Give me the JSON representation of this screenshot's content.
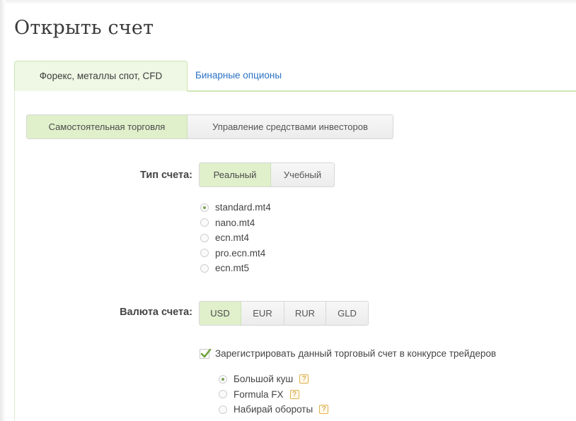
{
  "page": {
    "title": "Открыть счет"
  },
  "main_tabs": [
    {
      "label": "Форекс, металлы спот, CFD",
      "active": true
    },
    {
      "label": "Бинарные опционы",
      "active": false
    }
  ],
  "trade_mode": {
    "options": [
      {
        "label": "Самостоятельная торговля",
        "active": true
      },
      {
        "label": "Управление средствами инвесторов",
        "active": false
      }
    ]
  },
  "account_type": {
    "label": "Тип счета:",
    "options": [
      {
        "label": "Реальный",
        "active": true
      },
      {
        "label": "Учебный",
        "active": false
      }
    ],
    "platforms": [
      {
        "label": "standard.mt4",
        "checked": true
      },
      {
        "label": "nano.mt4",
        "checked": false
      },
      {
        "label": "ecn.mt4",
        "checked": false
      },
      {
        "label": "pro.ecn.mt4",
        "checked": false
      },
      {
        "label": "ecn.mt5",
        "checked": false
      }
    ]
  },
  "currency": {
    "label": "Валюта счета:",
    "options": [
      {
        "label": "USD",
        "active": true
      },
      {
        "label": "EUR",
        "active": false
      },
      {
        "label": "RUR",
        "active": false
      },
      {
        "label": "GLD",
        "active": false
      }
    ]
  },
  "contest": {
    "checkbox_label": "Зарегистрировать данный торговый счет в конкурсе трейдеров",
    "checked": true,
    "help_glyph": "?",
    "options": [
      {
        "label": "Большой куш",
        "checked": true
      },
      {
        "label": "Formula FX",
        "checked": false
      },
      {
        "label": "Набирай обороты",
        "checked": false
      }
    ]
  },
  "colors": {
    "accent_green": "#e0f0cb",
    "link_blue": "#2b72c4",
    "radio_dot": "#7da556",
    "help_orange": "#e0b24c"
  }
}
